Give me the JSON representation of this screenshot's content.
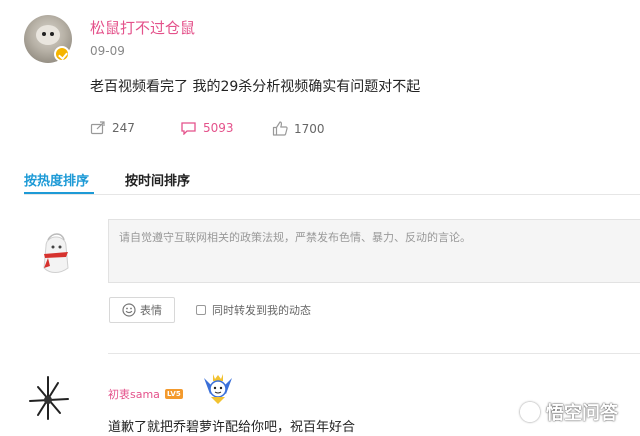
{
  "post": {
    "author": "松鼠打不过仓鼠",
    "date": "09-09",
    "text": "老百视频看完了 我的29杀分析视频确实有问题对不起",
    "reposts": "247",
    "comments": "5093",
    "likes": "1700"
  },
  "sort_tabs": {
    "hot": "按热度排序",
    "time": "按时间排序",
    "active": "hot"
  },
  "compose": {
    "placeholder": "请自觉遵守互联网相关的政策法规，严禁发布色情、暴力、反动的言论。",
    "emoji_label": "表情",
    "repost_label": "同时转发到我的动态",
    "repost_checked": false
  },
  "comment": {
    "user": "初衷sama",
    "level": "LV5",
    "text": "道歉了就把乔碧萝许配给你吧，祝百年好合"
  },
  "watermark": "悟空问答",
  "colors": {
    "accent": "#1d9ad6",
    "username": "#e4528b",
    "level_badge": "#f39a2d"
  },
  "icons": [
    "repost-icon",
    "comment-icon",
    "like-icon",
    "smiley-icon",
    "checkbox",
    "wukong-icon"
  ]
}
